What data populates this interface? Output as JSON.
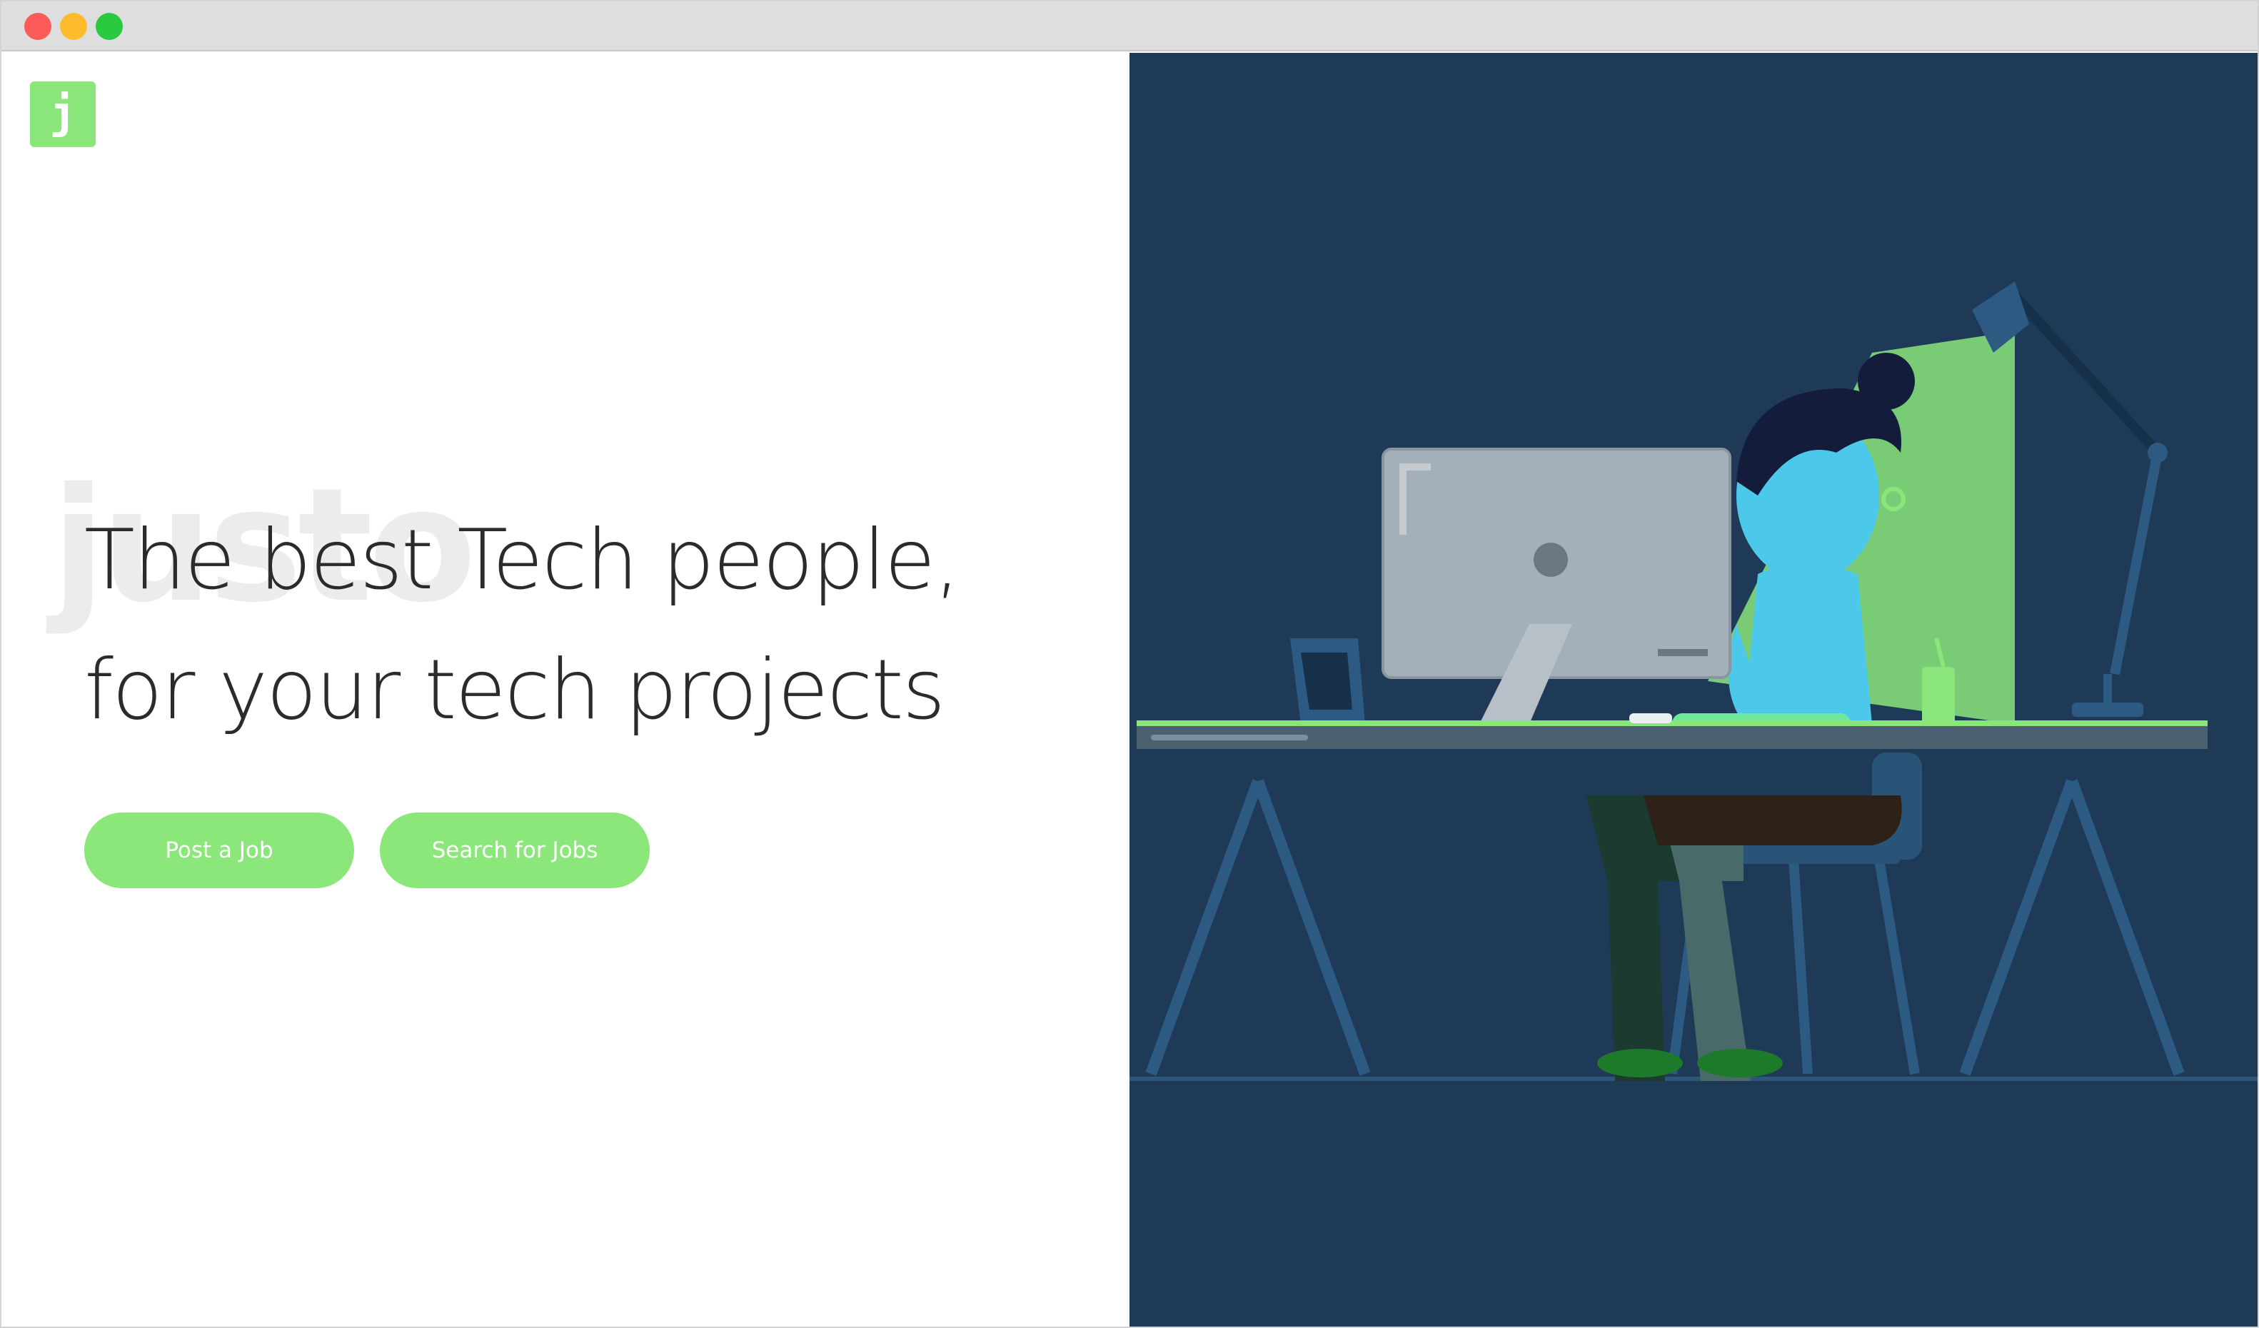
{
  "window": {
    "controls": [
      "close",
      "minimize",
      "maximize"
    ]
  },
  "brand": {
    "logo_letter": "j",
    "logo_color": "#8ae67a",
    "watermark_text": "justo"
  },
  "hero": {
    "headline_line1": "The best Tech people,",
    "headline_line2": "for your tech projects"
  },
  "actions": {
    "post_job_label": "Post a Job",
    "search_jobs_label": "Search for Jobs",
    "button_color": "#8ce77a"
  },
  "illustration": {
    "background_color": "#1e3a57",
    "description_icon": "person-at-desk-illustration"
  }
}
